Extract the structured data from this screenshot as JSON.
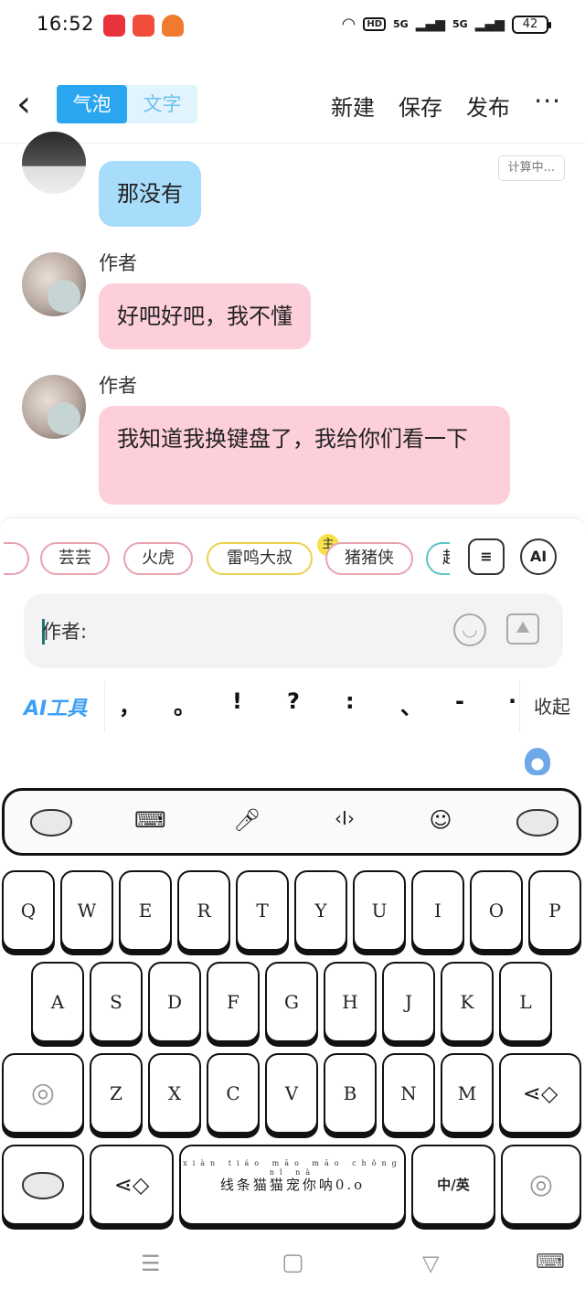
{
  "status_bar": {
    "time": "16:52",
    "hd": "HD",
    "signal1": "5G",
    "signal2": "5G",
    "battery": "42"
  },
  "header": {
    "tab_bubble": "气泡",
    "tab_text": "文字",
    "new": "新建",
    "save": "保存",
    "publish": "发布",
    "more": "···"
  },
  "chat": {
    "calc_badge": "计算中...",
    "messages": [
      {
        "text": "那没有"
      },
      {
        "author": "作者",
        "text": "好吧好吧，我不懂"
      },
      {
        "author": "作者",
        "text": "我知道我换键盘了，我给你们看一下"
      }
    ]
  },
  "panel": {
    "chips": [
      "芸芸",
      "火虎",
      "雷鸣大叔",
      "猪猪侠",
      "超"
    ],
    "host_badge": "主",
    "ai_button": "AI",
    "input_value": "作者:",
    "ai_tools": "AI工具",
    "punctuation": [
      "，",
      "。",
      "!",
      "?",
      ":",
      "、",
      "-",
      "·"
    ],
    "collapse": "收起"
  },
  "keyboard": {
    "row1": [
      "Q",
      "W",
      "E",
      "R",
      "T",
      "Y",
      "U",
      "I",
      "O",
      "P"
    ],
    "row2": [
      "A",
      "S",
      "D",
      "F",
      "G",
      "H",
      "J",
      "K",
      "L"
    ],
    "row3": [
      "Z",
      "X",
      "C",
      "V",
      "B",
      "N",
      "M"
    ],
    "space_label": "线条猫猫宠你呐0.o",
    "space_pinyin": "xiàn tiáo māo māo chǒng nǐ nà",
    "lang_switch": "中/英"
  },
  "icons": [
    "back-icon",
    "more-icon",
    "contact-card-icon",
    "emoji-icon",
    "image-icon",
    "keyboard-icon",
    "mic-icon",
    "cursor-icon",
    "smile-icon",
    "fish-icon",
    "swirl-icon",
    "menu-icon",
    "home-icon",
    "back-triangle-icon"
  ]
}
